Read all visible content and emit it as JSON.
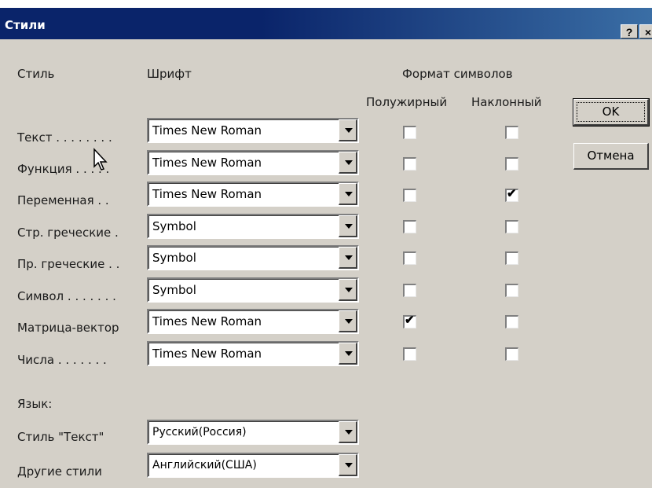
{
  "window": {
    "title": "Стили",
    "help_button": "?",
    "close_button": "×"
  },
  "headers": {
    "style": "Стиль",
    "font": "Шрифт",
    "char_format": "Формат символов",
    "bold": "Полужирный",
    "italic": "Наклонный"
  },
  "rows": [
    {
      "label": "Текст . . . . . . . .",
      "font": "Times New Roman",
      "bold": false,
      "italic": false
    },
    {
      "label": "Функция . . . . .",
      "font": "Times New Roman",
      "bold": false,
      "italic": false
    },
    {
      "label": "Переменная . .",
      "font": "Times New Roman",
      "bold": false,
      "italic": true
    },
    {
      "label": "Стр. греческие .",
      "font": "Symbol",
      "bold": false,
      "italic": false
    },
    {
      "label": "Пр. греческие . .",
      "font": "Symbol",
      "bold": false,
      "italic": false
    },
    {
      "label": "Символ . . . . . . .",
      "font": "Symbol",
      "bold": false,
      "italic": false
    },
    {
      "label": "Матрица-вектор",
      "font": "Times New Roman",
      "bold": true,
      "italic": false
    },
    {
      "label": "Числа . . . . . . .",
      "font": "Times New Roman",
      "bold": false,
      "italic": false
    }
  ],
  "language": {
    "heading": "Язык:",
    "text_style_label": "Стиль \"Текст\"",
    "text_style_value": "Русский(Россия)",
    "other_styles_label": "Другие стили",
    "other_styles_value": "Английский(США)"
  },
  "buttons": {
    "ok": "OK",
    "cancel": "Отмена"
  },
  "icons": {
    "checkmark": "✔",
    "cursor": "mouse-pointer-icon"
  },
  "colors": {
    "titlebar": "#0a246a",
    "dialog_bg": "#d4d0c8"
  }
}
